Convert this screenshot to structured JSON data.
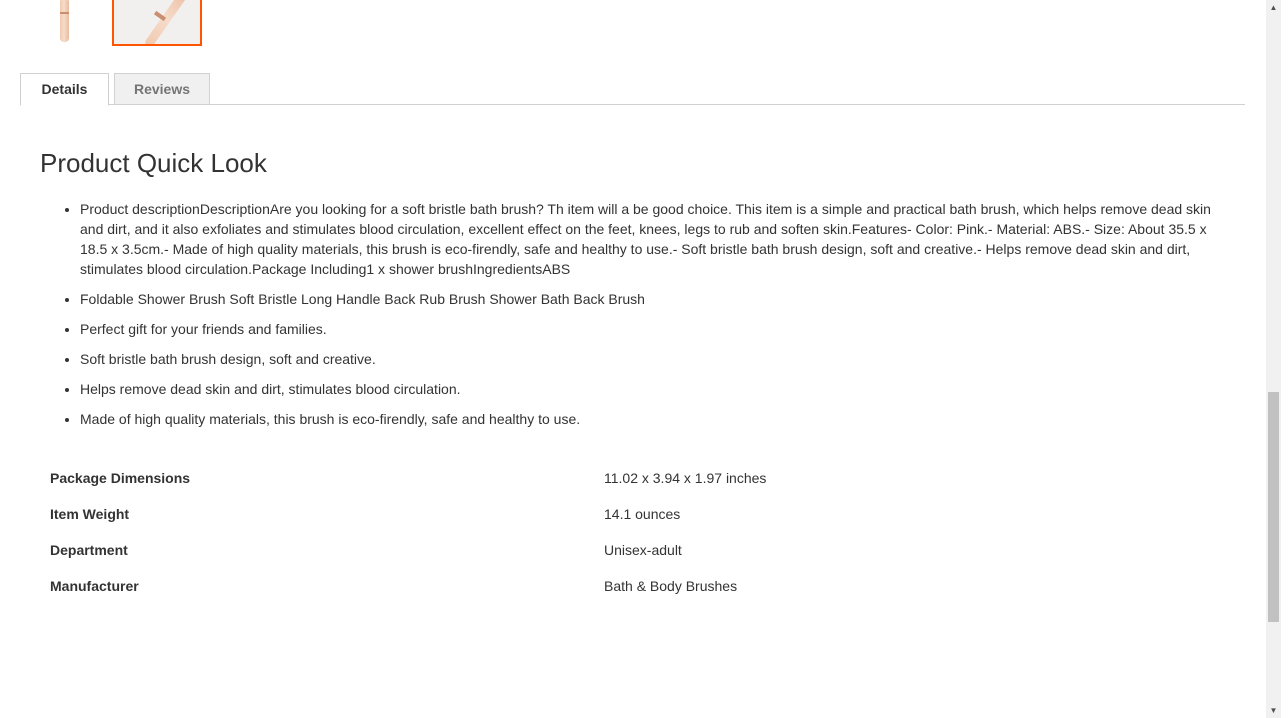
{
  "tabs": [
    {
      "label": "Details"
    },
    {
      "label": "Reviews"
    }
  ],
  "product": {
    "title": "Product Quick Look",
    "bullets": [
      "Product descriptionDescriptionAre you looking for a soft bristle bath brush? Th item will a be good choice. This item is a simple and practical bath brush, which helps remove dead skin and dirt, and it also exfoliates and stimulates blood circulation, excellent effect on the feet, knees, legs to rub and soften skin.Features- Color: Pink.- Material: ABS.- Size: About 35.5 x 18.5 x 3.5cm.- Made of high quality materials, this brush is eco-firendly, safe and healthy to use.- Soft bristle bath brush design, soft and creative.- Helps remove dead skin and dirt, stimulates blood circulation.Package Including1 x shower brushIngredientsABS",
      "Foldable Shower Brush Soft Bristle Long Handle Back Rub Brush Shower Bath Back Brush",
      "Perfect gift for your friends and families.",
      "Soft bristle bath brush design, soft and creative.",
      "Helps remove dead skin and dirt, stimulates blood circulation.",
      "Made of high quality materials, this brush is eco-firendly, safe and healthy to use."
    ],
    "specs": [
      {
        "label": "Package Dimensions",
        "value": "11.02 x 3.94 x 1.97 inches"
      },
      {
        "label": "Item Weight",
        "value": "14.1 ounces"
      },
      {
        "label": "Department",
        "value": "Unisex-adult"
      },
      {
        "label": "Manufacturer",
        "value": "Bath & Body Brushes"
      }
    ]
  },
  "colors": {
    "accent": "#ff5501",
    "tab_inactive_bg": "#f0f0f0",
    "border": "#d1d1d1"
  },
  "icons": {
    "scroll_up": "▲",
    "scroll_down": "▼"
  }
}
